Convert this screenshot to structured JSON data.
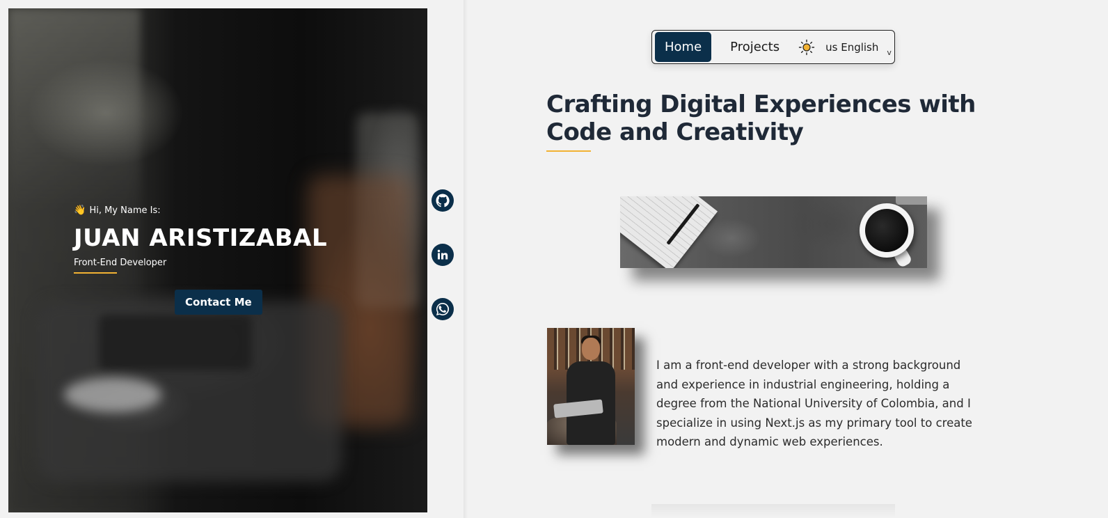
{
  "hero": {
    "greeting_emoji": "👋",
    "greeting": "Hi, My Name Is:",
    "name": "JUAN ARISTIZABAL",
    "role": "Front-End Developer",
    "contact_label": "Contact Me"
  },
  "social": [
    {
      "icon": "github-icon"
    },
    {
      "icon": "linkedin-icon"
    },
    {
      "icon": "whatsapp-icon"
    }
  ],
  "nav": {
    "home": "Home",
    "projects": "Projects",
    "theme_icon": "sun-icon",
    "language": "us English",
    "language_caret": "v"
  },
  "main": {
    "headline": "Crafting Digital Experiences with Code and Creativity",
    "bio": "I am a front-end developer with a strong background and experience in industrial engineering, holding a degree from the National University of Colombia, and I specialize in using Next.js as my primary tool to create modern and dynamic web experiences."
  },
  "colors": {
    "primary": "#0b2f4a",
    "accent": "#f2b233",
    "background": "#f2f2f2",
    "text": "#1f2937"
  }
}
